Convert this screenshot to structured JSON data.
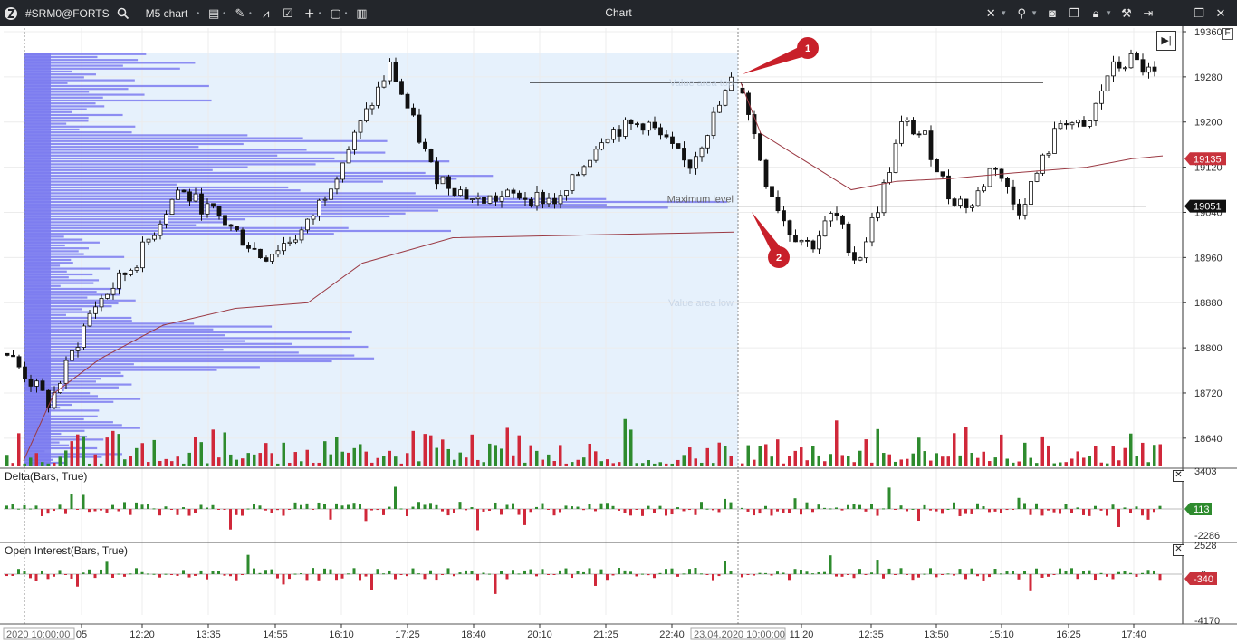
{
  "toolbar": {
    "symbol": "#SRM0@FORTS",
    "chart_name": "M5 chart",
    "title": "Chart",
    "icons": [
      "logo-icon",
      "search-icon",
      "template-icon",
      "pencil-icon",
      "indicator-icon",
      "edit-icon",
      "plus-icon",
      "window-icon",
      "layout-icon",
      "cross-icon",
      "link-icon",
      "camera-icon",
      "copy-icon",
      "lock-icon",
      "tools-icon",
      "pin-icon",
      "minimize-icon",
      "restore-icon",
      "close-icon"
    ]
  },
  "colors": {
    "up_volume": "#2e8b2e",
    "down_volume": "#d0283a",
    "profile": "#7b7bf0",
    "value_area": "#e6f1fc",
    "vwap": "#9b3a44",
    "badge_red": "#c8323c",
    "badge_green": "#2e8b2e"
  },
  "chart_data": {
    "type": "candlestick",
    "price_axis": {
      "ticks": [
        "19360",
        "19280",
        "19200",
        "19120",
        "19040",
        "18960",
        "18880",
        "18800",
        "18720",
        "18640"
      ],
      "ylim": [
        18590,
        19360
      ]
    },
    "time_axis": {
      "ticks": [
        "05",
        "12:20",
        "13:35",
        "14:55",
        "16:10",
        "17:25",
        "18:40",
        "20:10",
        "21:25",
        "22:40",
        "11:20",
        "12:35",
        "13:50",
        "15:10",
        "16:25",
        "17:40"
      ],
      "session_start_1": "2020 10:00:00",
      "session_start_2": "23.04.2020 10:00:00"
    },
    "annotations": {
      "value_area_top": "Value area top",
      "maximum_level": "Maximum level",
      "value_area_low": "Value area low",
      "marker_1": "1",
      "marker_2": "2"
    },
    "levels": {
      "value_area_top": 19270,
      "maximum_level": 19051,
      "value_area_low": 18880
    },
    "price_badges": [
      {
        "value": "19135",
        "color": "red"
      },
      {
        "value": "19051",
        "color": "black"
      }
    ],
    "delta_panel": {
      "title": "Delta(Bars, True)",
      "max_label": "3403",
      "min_label": "-2286",
      "badge": "113"
    },
    "oi_panel": {
      "title": "Open Interest(Bars, True)",
      "max_label": "2528",
      "zero_label": "0",
      "min_label": "-4170",
      "badge": "-340"
    }
  }
}
